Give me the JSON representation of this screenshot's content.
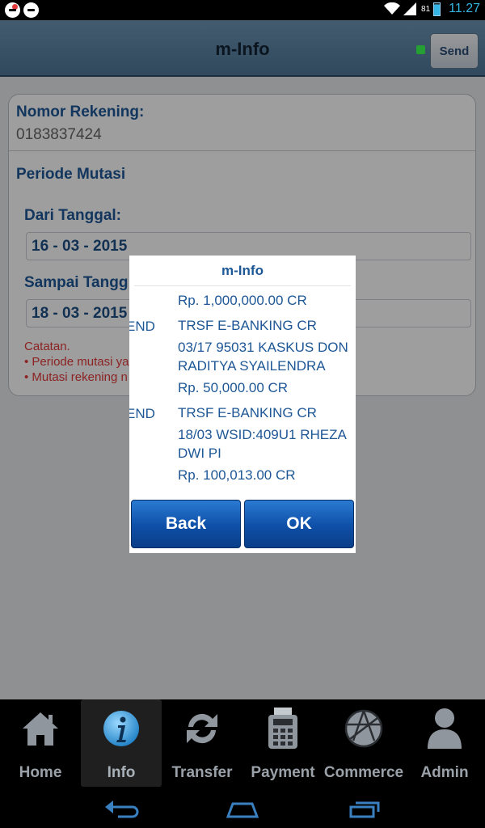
{
  "status_bar": {
    "battery": "81",
    "time": "11.27"
  },
  "header": {
    "title": "m-Info",
    "send_label": "Send"
  },
  "form": {
    "account_label": "Nomor Rekening:",
    "account_value": "0183837424",
    "period_label": "Periode Mutasi",
    "from_label": "Dari Tanggal:",
    "from_value": "16 - 03 - 2015",
    "to_label": "Sampai Tangg",
    "to_value": "18 - 03 - 2015",
    "note_title": "Catatan.",
    "note_1": "• Periode mutasi ya",
    "note_2": "• Mutasi rekening n"
  },
  "dialog": {
    "title": "m-Info",
    "lines": [
      "Rp. 1,000,000.00 CR",
      "TRSF E-BANKING CR",
      "03/17 95031 KASKUS DON",
      "RADITYA SYAILENDRA",
      "Rp. 50,000.00 CR",
      "TRSF E-BANKING CR",
      "18/03 WSID:409U1 RHEZA",
      "DWI PI",
      "Rp. 100,013.00 CR"
    ],
    "side_1": "END",
    "side_2": "END",
    "back_label": "Back",
    "ok_label": "OK"
  },
  "tabs": [
    {
      "label": "Home",
      "icon": "home-icon"
    },
    {
      "label": "Info",
      "icon": "info-icon",
      "active": true
    },
    {
      "label": "Transfer",
      "icon": "transfer-icon"
    },
    {
      "label": "Payment",
      "icon": "payment-icon"
    },
    {
      "label": "Commerce",
      "icon": "commerce-icon"
    },
    {
      "label": "Admin",
      "icon": "admin-icon"
    }
  ],
  "colors": {
    "accent": "#1d5796",
    "note_red": "#e23838",
    "button_blue": "#0e4fa7",
    "indicator_green": "#3cff55"
  }
}
